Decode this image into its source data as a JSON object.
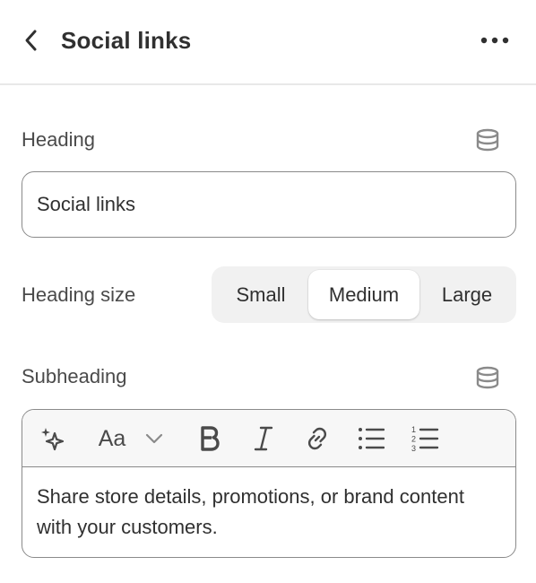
{
  "header": {
    "title": "Social links"
  },
  "heading": {
    "label": "Heading",
    "value": "Social links"
  },
  "heading_size": {
    "label": "Heading size",
    "options": [
      "Small",
      "Medium",
      "Large"
    ],
    "selected": "Medium"
  },
  "subheading": {
    "label": "Subheading",
    "toolbar": [
      "sparkle-icon",
      "font-size-icon",
      "chevron-down-icon",
      "bold-icon",
      "italic-icon",
      "link-icon",
      "bullet-list-icon",
      "numbered-list-icon"
    ],
    "font_button": "Aa",
    "content": "Share store details, promotions, or brand content with your customers."
  },
  "colors": {
    "text": "#303030",
    "label": "#4a4a4a",
    "border": "#8a8a8a",
    "segment_bg": "#f1f1f1",
    "toolbar_bg": "#f7f7f7"
  }
}
